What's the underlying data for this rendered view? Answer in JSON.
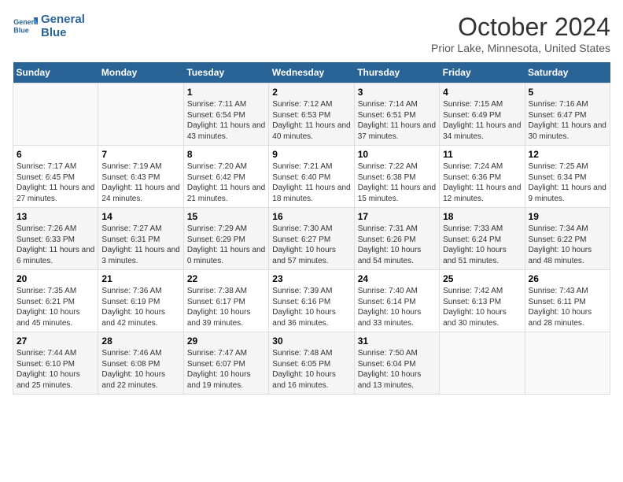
{
  "header": {
    "logo_line1": "General",
    "logo_line2": "Blue",
    "month": "October 2024",
    "location": "Prior Lake, Minnesota, United States"
  },
  "weekdays": [
    "Sunday",
    "Monday",
    "Tuesday",
    "Wednesday",
    "Thursday",
    "Friday",
    "Saturday"
  ],
  "weeks": [
    [
      {
        "day": "",
        "sunrise": "",
        "sunset": "",
        "daylight": ""
      },
      {
        "day": "",
        "sunrise": "",
        "sunset": "",
        "daylight": ""
      },
      {
        "day": "1",
        "sunrise": "Sunrise: 7:11 AM",
        "sunset": "Sunset: 6:54 PM",
        "daylight": "Daylight: 11 hours and 43 minutes."
      },
      {
        "day": "2",
        "sunrise": "Sunrise: 7:12 AM",
        "sunset": "Sunset: 6:53 PM",
        "daylight": "Daylight: 11 hours and 40 minutes."
      },
      {
        "day": "3",
        "sunrise": "Sunrise: 7:14 AM",
        "sunset": "Sunset: 6:51 PM",
        "daylight": "Daylight: 11 hours and 37 minutes."
      },
      {
        "day": "4",
        "sunrise": "Sunrise: 7:15 AM",
        "sunset": "Sunset: 6:49 PM",
        "daylight": "Daylight: 11 hours and 34 minutes."
      },
      {
        "day": "5",
        "sunrise": "Sunrise: 7:16 AM",
        "sunset": "Sunset: 6:47 PM",
        "daylight": "Daylight: 11 hours and 30 minutes."
      }
    ],
    [
      {
        "day": "6",
        "sunrise": "Sunrise: 7:17 AM",
        "sunset": "Sunset: 6:45 PM",
        "daylight": "Daylight: 11 hours and 27 minutes."
      },
      {
        "day": "7",
        "sunrise": "Sunrise: 7:19 AM",
        "sunset": "Sunset: 6:43 PM",
        "daylight": "Daylight: 11 hours and 24 minutes."
      },
      {
        "day": "8",
        "sunrise": "Sunrise: 7:20 AM",
        "sunset": "Sunset: 6:42 PM",
        "daylight": "Daylight: 11 hours and 21 minutes."
      },
      {
        "day": "9",
        "sunrise": "Sunrise: 7:21 AM",
        "sunset": "Sunset: 6:40 PM",
        "daylight": "Daylight: 11 hours and 18 minutes."
      },
      {
        "day": "10",
        "sunrise": "Sunrise: 7:22 AM",
        "sunset": "Sunset: 6:38 PM",
        "daylight": "Daylight: 11 hours and 15 minutes."
      },
      {
        "day": "11",
        "sunrise": "Sunrise: 7:24 AM",
        "sunset": "Sunset: 6:36 PM",
        "daylight": "Daylight: 11 hours and 12 minutes."
      },
      {
        "day": "12",
        "sunrise": "Sunrise: 7:25 AM",
        "sunset": "Sunset: 6:34 PM",
        "daylight": "Daylight: 11 hours and 9 minutes."
      }
    ],
    [
      {
        "day": "13",
        "sunrise": "Sunrise: 7:26 AM",
        "sunset": "Sunset: 6:33 PM",
        "daylight": "Daylight: 11 hours and 6 minutes."
      },
      {
        "day": "14",
        "sunrise": "Sunrise: 7:27 AM",
        "sunset": "Sunset: 6:31 PM",
        "daylight": "Daylight: 11 hours and 3 minutes."
      },
      {
        "day": "15",
        "sunrise": "Sunrise: 7:29 AM",
        "sunset": "Sunset: 6:29 PM",
        "daylight": "Daylight: 11 hours and 0 minutes."
      },
      {
        "day": "16",
        "sunrise": "Sunrise: 7:30 AM",
        "sunset": "Sunset: 6:27 PM",
        "daylight": "Daylight: 10 hours and 57 minutes."
      },
      {
        "day": "17",
        "sunrise": "Sunrise: 7:31 AM",
        "sunset": "Sunset: 6:26 PM",
        "daylight": "Daylight: 10 hours and 54 minutes."
      },
      {
        "day": "18",
        "sunrise": "Sunrise: 7:33 AM",
        "sunset": "Sunset: 6:24 PM",
        "daylight": "Daylight: 10 hours and 51 minutes."
      },
      {
        "day": "19",
        "sunrise": "Sunrise: 7:34 AM",
        "sunset": "Sunset: 6:22 PM",
        "daylight": "Daylight: 10 hours and 48 minutes."
      }
    ],
    [
      {
        "day": "20",
        "sunrise": "Sunrise: 7:35 AM",
        "sunset": "Sunset: 6:21 PM",
        "daylight": "Daylight: 10 hours and 45 minutes."
      },
      {
        "day": "21",
        "sunrise": "Sunrise: 7:36 AM",
        "sunset": "Sunset: 6:19 PM",
        "daylight": "Daylight: 10 hours and 42 minutes."
      },
      {
        "day": "22",
        "sunrise": "Sunrise: 7:38 AM",
        "sunset": "Sunset: 6:17 PM",
        "daylight": "Daylight: 10 hours and 39 minutes."
      },
      {
        "day": "23",
        "sunrise": "Sunrise: 7:39 AM",
        "sunset": "Sunset: 6:16 PM",
        "daylight": "Daylight: 10 hours and 36 minutes."
      },
      {
        "day": "24",
        "sunrise": "Sunrise: 7:40 AM",
        "sunset": "Sunset: 6:14 PM",
        "daylight": "Daylight: 10 hours and 33 minutes."
      },
      {
        "day": "25",
        "sunrise": "Sunrise: 7:42 AM",
        "sunset": "Sunset: 6:13 PM",
        "daylight": "Daylight: 10 hours and 30 minutes."
      },
      {
        "day": "26",
        "sunrise": "Sunrise: 7:43 AM",
        "sunset": "Sunset: 6:11 PM",
        "daylight": "Daylight: 10 hours and 28 minutes."
      }
    ],
    [
      {
        "day": "27",
        "sunrise": "Sunrise: 7:44 AM",
        "sunset": "Sunset: 6:10 PM",
        "daylight": "Daylight: 10 hours and 25 minutes."
      },
      {
        "day": "28",
        "sunrise": "Sunrise: 7:46 AM",
        "sunset": "Sunset: 6:08 PM",
        "daylight": "Daylight: 10 hours and 22 minutes."
      },
      {
        "day": "29",
        "sunrise": "Sunrise: 7:47 AM",
        "sunset": "Sunset: 6:07 PM",
        "daylight": "Daylight: 10 hours and 19 minutes."
      },
      {
        "day": "30",
        "sunrise": "Sunrise: 7:48 AM",
        "sunset": "Sunset: 6:05 PM",
        "daylight": "Daylight: 10 hours and 16 minutes."
      },
      {
        "day": "31",
        "sunrise": "Sunrise: 7:50 AM",
        "sunset": "Sunset: 6:04 PM",
        "daylight": "Daylight: 10 hours and 13 minutes."
      },
      {
        "day": "",
        "sunrise": "",
        "sunset": "",
        "daylight": ""
      },
      {
        "day": "",
        "sunrise": "",
        "sunset": "",
        "daylight": ""
      }
    ]
  ]
}
